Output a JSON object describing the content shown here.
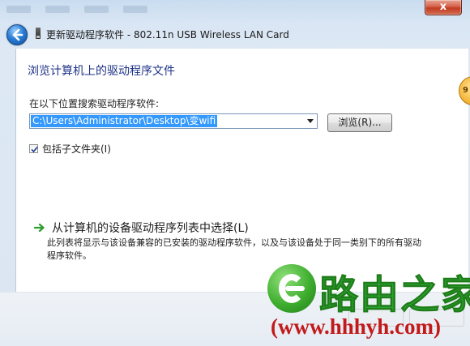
{
  "window": {
    "title": "更新驱动程序软件 - 802.11n USB Wireless LAN Card",
    "close_label": "x"
  },
  "content": {
    "heading": "浏览计算机上的驱动程序文件",
    "search_label": "在以下位置搜索驱动程序软件:",
    "path_value": "C:\\Users\\Administrator\\Desktop\\变wifi",
    "browse_label": "浏览(R)...",
    "include_subfolders_label": "包括子文件夹(I)",
    "include_subfolders_checked": true,
    "pick_title": "从计算机的设备驱动程序列表中选择(L)",
    "pick_desc": "此列表将显示与该设备兼容的已安装的驱动程序软件，以及与该设备处于同一类别下的所有驱动程序软件。"
  },
  "side_badge": "9",
  "watermark": {
    "brand": "路由之家",
    "url": "(www.hhhyh.com)"
  },
  "icons": {
    "back": "back-arrow-icon",
    "device": "usb-device-icon",
    "link_arrow": "green-arrow-icon",
    "checkbox": "checkmark-icon"
  },
  "colors": {
    "heading": "#1e3287",
    "selection": "#3399ff",
    "link_arrow": "#2e9e2e",
    "close": "#c23c22"
  }
}
